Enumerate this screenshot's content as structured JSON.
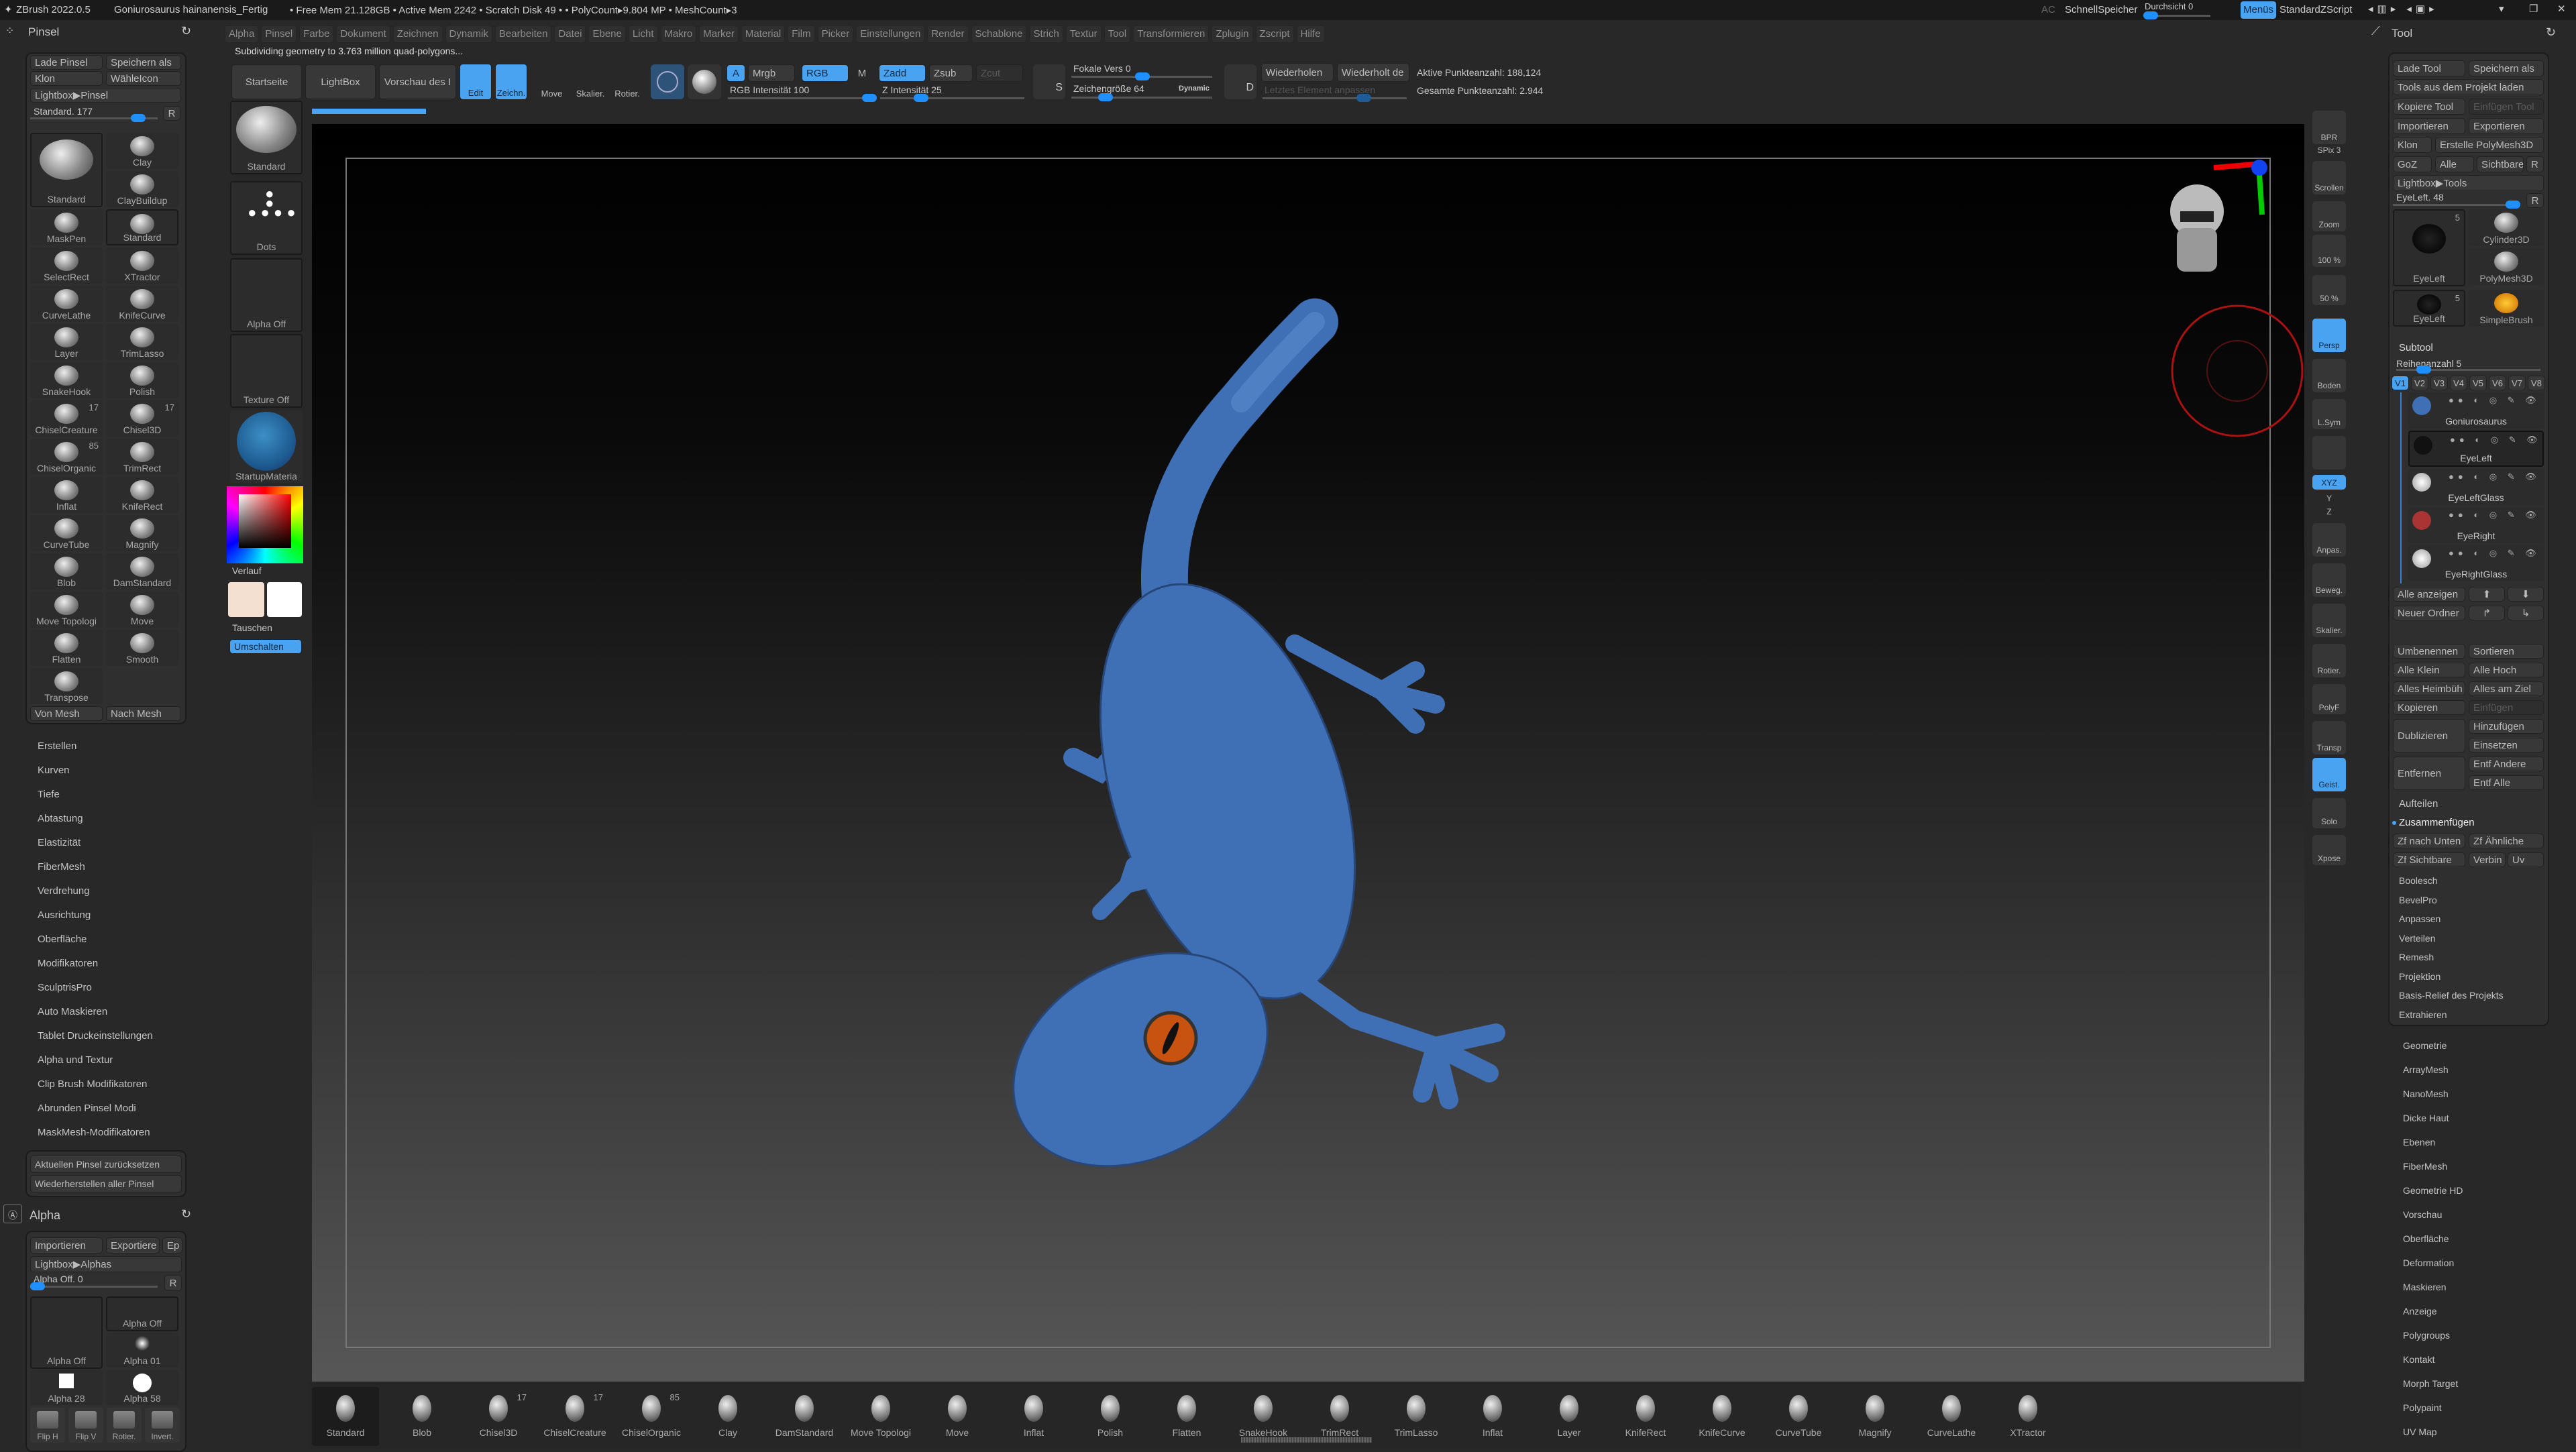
{
  "titlebar": {
    "app": "ZBrush 2022.0.5",
    "file": "Goniurosaurus hainanensis_Fertig",
    "stats": "• Free Mem 21.128GB • Active Mem 2242 • Scratch Disk 49 • • PolyCount▸9.804 MP • MeshCount▸3",
    "ac": "AC",
    "quicksave": "SchnellSpeicher",
    "transparency": "Durchsicht 0",
    "menus": "Menüs",
    "zscript": "StandardZScript"
  },
  "menubar": [
    "Alpha",
    "Pinsel",
    "Farbe",
    "Dokument",
    "Zeichnen",
    "Dynamik",
    "Bearbeiten",
    "Datei",
    "Ebene",
    "Licht",
    "Makro",
    "Marker",
    "Material",
    "Film",
    "Picker",
    "Einstellungen",
    "Render",
    "Schablone",
    "Strich",
    "Textur",
    "Tool",
    "Transformieren",
    "Zplugin",
    "Zscript",
    "Hilfe"
  ],
  "status": "Subdividing geometry to 3.763 million quad-polygons...",
  "toolbar": {
    "home": "Startseite",
    "lightbox": "LightBox",
    "preview": "Vorschau des I",
    "edit": "Edit",
    "draw": "Zeichn.",
    "move": "Move",
    "scale": "Skalier.",
    "rotate": "Rotier.",
    "a": "A",
    "mrgb": "Mrgb",
    "rgb": "RGB",
    "m": "M",
    "zadd": "Zadd",
    "zsub": "Zsub",
    "zcut": "Zcut",
    "rgb_intensity": "RGB Intensität 100",
    "z_intensity": "Z Intensität 25",
    "focal": "Fokale Vers 0",
    "draw_size": "Zeichengröße 64",
    "dynamic": "Dynamic",
    "repeat": "Wiederholen",
    "repeat_last": "Wiederholt de",
    "adjust_last": "Letztes Element anpassen",
    "active_points": "Aktive Punkteanzahl: 188,124",
    "total_points": "Gesamte Punkteanzahl: 2.944",
    "s": "S",
    "d": "D"
  },
  "left": {
    "title": "Pinsel",
    "load": "Lade Pinsel",
    "save": "Speichern als",
    "clone": "Klon",
    "icon": "WähleIcon",
    "lightbox": "Lightbox▶Pinsel",
    "slider": "Standard. 177",
    "r": "R",
    "brushes": [
      {
        "label": "Standard"
      },
      {
        "label": "Clay"
      },
      {
        "label": "ClayBuildup"
      },
      {
        "label": "MaskPen"
      },
      {
        "label": "Standard"
      },
      {
        "label": "SelectRect"
      },
      {
        "label": "XTractor"
      },
      {
        "label": "CurveLathe"
      },
      {
        "label": "KnifeCurve"
      },
      {
        "label": "Layer"
      },
      {
        "label": "TrimLasso"
      },
      {
        "label": "SnakeHook"
      },
      {
        "label": "Polish"
      },
      {
        "label": "ChiselCreature",
        "num": "17"
      },
      {
        "label": "Chisel3D",
        "num": "17"
      },
      {
        "label": "ChiselOrganic",
        "num": "85"
      },
      {
        "label": "TrimRect"
      },
      {
        "label": "Inflat"
      },
      {
        "label": "KnifeRect"
      },
      {
        "label": "CurveTube"
      },
      {
        "label": "Magnify"
      },
      {
        "label": "Blob"
      },
      {
        "label": "DamStandard"
      },
      {
        "label": "Move Topologi"
      },
      {
        "label": "Move"
      },
      {
        "label": "Flatten"
      },
      {
        "label": "Smooth"
      },
      {
        "label": "Transpose"
      }
    ],
    "from_mesh": "Von Mesh",
    "to_mesh": "Nach Mesh",
    "menu": [
      "Erstellen",
      "Kurven",
      "Tiefe",
      "Abtastung",
      "Elastizität",
      "FiberMesh",
      "Verdrehung",
      "Ausrichtung",
      "Oberfläche",
      "Modifikatoren",
      "SculptrisPro",
      "Auto Maskieren",
      "Tablet Druckeinstellungen",
      "Alpha und Textur",
      "Clip Brush Modifikatoren",
      "Abrunden Pinsel Modi",
      "MaskMesh-Modifikatoren"
    ],
    "reset_current": "Aktuellen Pinsel zurücksetzen",
    "restore_all": "Wiederherstellen aller Pinsel"
  },
  "alpha": {
    "title": "Alpha",
    "import": "Importieren",
    "export": "Exportiere",
    "ep": "Ep",
    "lightbox": "Lightbox▶Alphas",
    "slider": "Alpha Off. 0",
    "r": "R",
    "current": "Alpha Off",
    "items": [
      "Alpha Off",
      "Alpha 01",
      "Alpha 28",
      "Alpha 58"
    ],
    "tools": [
      "Flip H",
      "Flip V",
      "Rotier.",
      "Invert."
    ]
  },
  "shelf2": {
    "brush": "Standard",
    "stroke": "Dots",
    "alpha": "Alpha Off",
    "texture": "Texture Off",
    "material": "StartupMateria",
    "gradient": "Verlauf",
    "swap": "Tauschen",
    "switch": "Umschalten",
    "main_color": "#f3e0d0",
    "secondary_color": "#ffffff"
  },
  "vtoolbar": [
    {
      "label": "BPR"
    },
    {
      "label": "SPix 3"
    },
    {
      "label": "Scrollen"
    },
    {
      "label": "Zoom"
    },
    {
      "label": "100 %"
    },
    {
      "label": "50 %"
    },
    {
      "label": "Persp",
      "active": true
    },
    {
      "label": "Boden"
    },
    {
      "label": "L.Sym"
    },
    {
      "label": ""
    },
    {
      "label": "XYZ",
      "active": true
    },
    {
      "label": "Y"
    },
    {
      "label": "Z"
    },
    {
      "label": "Anpas."
    },
    {
      "label": "Beweg."
    },
    {
      "label": "Skalier."
    },
    {
      "label": "Rotier."
    },
    {
      "label": "PolyF"
    },
    {
      "label": "Transp"
    },
    {
      "label": "Geist.",
      "active": true
    },
    {
      "label": "Solo"
    },
    {
      "label": "Xpose"
    }
  ],
  "tool": {
    "title": "Tool",
    "load": "Lade Tool",
    "save": "Speichern als",
    "project": "Tools aus dem Projekt laden",
    "copy": "Kopiere Tool",
    "paste": "Einfügen Tool",
    "import": "Importieren",
    "export": "Exportieren",
    "clone": "Klon",
    "polymesh": "Erstelle PolyMesh3D",
    "goz": "GoZ",
    "all": "Alle",
    "visible": "Sichtbare",
    "r": "R",
    "lightbox": "Lightbox▶Tools",
    "slider": "EyeLeft. 48",
    "thumbs": [
      {
        "label": "EyeLeft",
        "num": "5"
      },
      {
        "label": "Cylinder3D"
      },
      {
        "label": "PolyMesh3D"
      },
      {
        "label": "EyeLeft",
        "num": "5"
      },
      {
        "label": "SimpleBrush"
      }
    ],
    "subtool_title": "Subtool",
    "rows": "Reihenanzahl 5",
    "versions": [
      "V1",
      "V2",
      "V3",
      "V4",
      "V5",
      "V6",
      "V7",
      "V8"
    ],
    "subtools": [
      "Goniurosaurus",
      "EyeLeft",
      "EyeLeftGlass",
      "EyeRight",
      "EyeRightGlass"
    ],
    "show_all": "Alle anzeigen",
    "new_folder": "Neuer Ordner",
    "rename": "Umbenennen",
    "sort": "Sortieren",
    "all_low": "Alle Klein",
    "all_high": "Alle Hoch",
    "all_home": "Alles Heimbüh",
    "all_target": "Alles am Ziel",
    "copy2": "Kopieren",
    "paste2": "Einfügen",
    "duplicate": "Dublizieren",
    "append": "Hinzufügen",
    "insert": "Einsetzen",
    "delete": "Entfernen",
    "del_other": "Entf Andere",
    "del_all": "Entf Alle",
    "split": "Aufteilen",
    "merge": "Zusammenfügen",
    "merge_down": "Zf nach Unten",
    "merge_similar": "Zf Ähnliche",
    "merge_visible": "Zf Sichtbare",
    "weld": "Verbin",
    "uv": "Uv",
    "sub_menu": [
      "Boolesch",
      "BevelPro",
      "Anpassen",
      "Verteilen",
      "Remesh",
      "Projektion",
      "Basis-Relief des Projekts",
      "Extrahieren"
    ],
    "menu": [
      "Geometrie",
      "ArrayMesh",
      "NanoMesh",
      "Dicke Haut",
      "Ebenen",
      "FiberMesh",
      "Geometrie HD",
      "Vorschau",
      "Oberfläche",
      "Deformation",
      "Maskieren",
      "Anzeige",
      "Polygroups",
      "Kontakt",
      "Morph Target",
      "Polypaint",
      "UV Map"
    ]
  },
  "bottom_shelf": [
    {
      "label": "Standard"
    },
    {
      "label": "Blob"
    },
    {
      "label": "Chisel3D",
      "num": "17"
    },
    {
      "label": "ChiselCreature",
      "num": "17"
    },
    {
      "label": "ChiselOrganic",
      "num": "85"
    },
    {
      "label": "Clay"
    },
    {
      "label": "DamStandard"
    },
    {
      "label": "Move Topologi"
    },
    {
      "label": "Move"
    },
    {
      "label": "Inflat"
    },
    {
      "label": "Polish"
    },
    {
      "label": "Flatten"
    },
    {
      "label": "SnakeHook"
    },
    {
      "label": "TrimRect"
    },
    {
      "label": "TrimLasso"
    },
    {
      "label": "Inflat"
    },
    {
      "label": "Layer"
    },
    {
      "label": "KnifeRect"
    },
    {
      "label": "KnifeCurve"
    },
    {
      "label": "CurveTube"
    },
    {
      "label": "Magnify"
    },
    {
      "label": "CurveLathe"
    },
    {
      "label": "XTractor"
    }
  ],
  "colors": {
    "accent": "#4aa3f0",
    "model": "#3f6fb5"
  }
}
